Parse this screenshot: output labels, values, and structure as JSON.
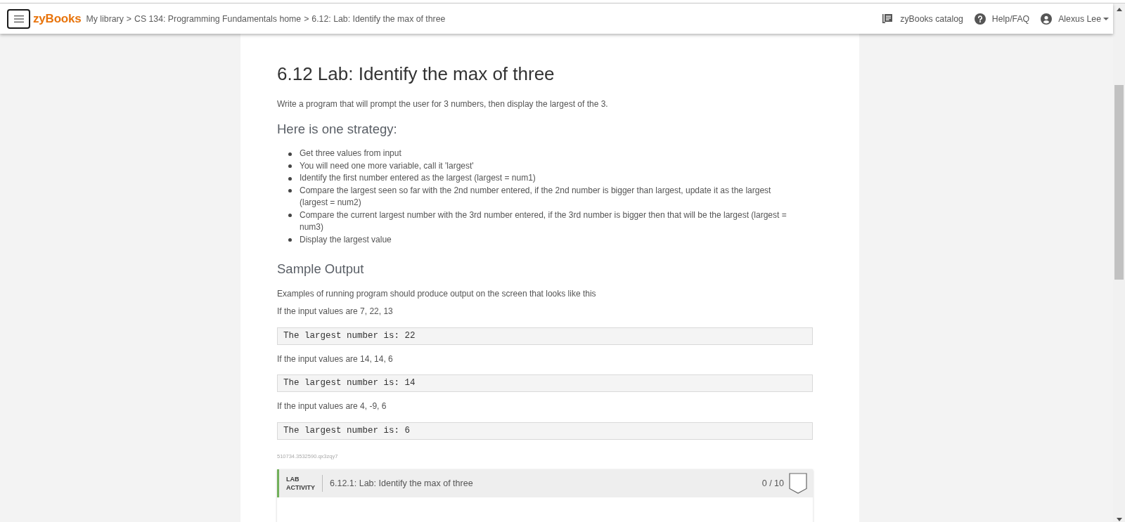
{
  "header": {
    "logo": "zyBooks",
    "breadcrumb": [
      {
        "label": "My library",
        "separator": ">"
      },
      {
        "label": "CS 134: Programming Fundamentals home",
        "separator": ">"
      },
      {
        "label": "6.12: Lab: Identify the max of three"
      }
    ],
    "links": [
      {
        "kind": "catalog",
        "label": "zyBooks catalog"
      },
      {
        "kind": "help",
        "label": "Help/FAQ"
      }
    ],
    "user": {
      "name": "Alexus Lee"
    }
  },
  "section": {
    "title": "6.12 Lab: Identify the max of three",
    "intro": "Write a program that will prompt the user for 3 numbers, then display the largest of the 3.",
    "strategy_heading": "Here is one strategy:",
    "strategy_steps": [
      "Get three values from input",
      "You will need one more variable, call it 'largest'",
      "Identify the first number entered as the largest (largest = num1)",
      "Compare the largest seen so far with the 2nd number entered, if the 2nd number is bigger than largest, update it as the largest (largest = num2)",
      "Compare the current largest number with the 3rd number entered, if the 3rd number is bigger then that will be the largest (largest = num3)",
      "Display the largest value"
    ],
    "sample_heading": "Sample Output",
    "sample_intro": "Examples of running program should produce output on the screen that looks like this",
    "examples": [
      {
        "input_note": "If the input values are 7, 22, 13",
        "output": "The largest number is: 22"
      },
      {
        "input_note": "If the input values are 14, 14, 6",
        "output": "The largest number is: 14"
      },
      {
        "input_note": "If the input values are 4, -9, 6",
        "output": "The largest number is: 6"
      }
    ],
    "reference_id": "510734.3532590.qx3zqy7"
  },
  "lab_activity": {
    "type_label": "LAB ACTIVITY",
    "title": "6.12.1: Lab: Identify the max of three",
    "score": "0 / 10",
    "completed": false
  }
}
